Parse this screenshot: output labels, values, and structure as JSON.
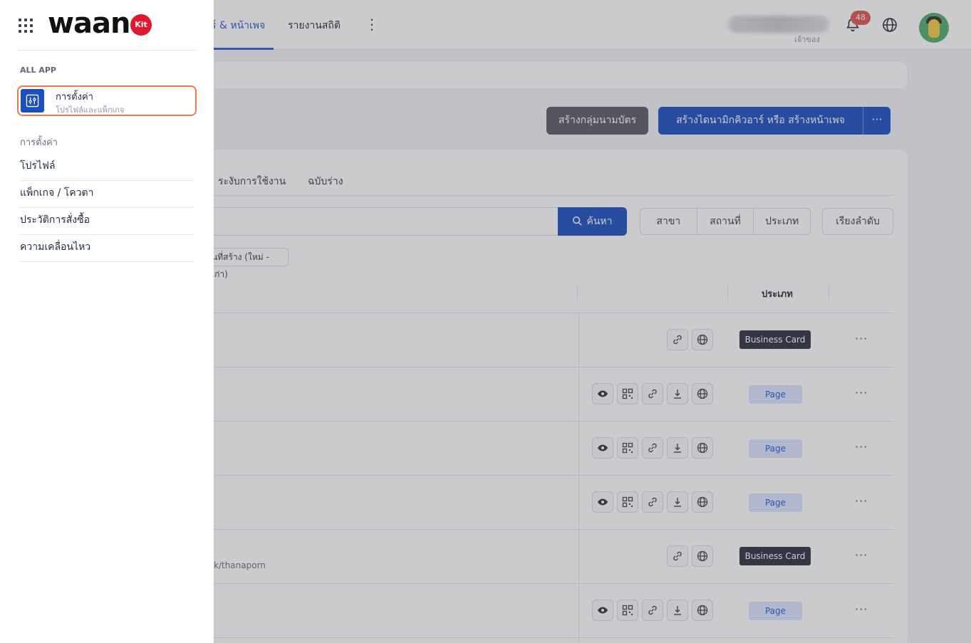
{
  "topnav": {
    "tabs": [
      {
        "label": "ร์ & หน้าเพจ",
        "active": true
      },
      {
        "label": "รายงานสถิติ",
        "active": false
      }
    ],
    "user_role": "เจ้าของ",
    "notification_count": "48"
  },
  "actions": {
    "create_group": "สร้างกลุ่มนามบัตร",
    "create_dynamic": "สร้างไดนามิกคิวอาร์ หรือ สร้างหน้าเพจ",
    "more": "···"
  },
  "panel": {
    "tabs": [
      "ระงับการใช้งาน",
      "ฉบับร่าง"
    ],
    "search_button": "ค้นหา",
    "filters": [
      "สาขา",
      "สถานที่",
      "ประเภท"
    ],
    "sort_button": "เรียงลำดับ",
    "active_chip": "นที่สร้าง (ใหม่ - เก่า)",
    "col_type": "ประเภท",
    "rows": [
      {
        "type": "Business Card"
      },
      {
        "type": "Page"
      },
      {
        "type": "Page"
      },
      {
        "type": "Page"
      },
      {
        "type": "Business Card",
        "url": "k/thanaporn"
      },
      {
        "type": "Page"
      }
    ]
  },
  "drawer": {
    "logo_text": "waan",
    "logo_badge": "Kit",
    "all_app_label": "ALL APP",
    "app": {
      "title": "การตั้งค่า",
      "subtitle": "โปรไฟล์และแพ็กเกจ"
    },
    "section_title": "การตั้งค่า",
    "menu": [
      "โปรไฟล์",
      "แพ็กเกจ / โควตา",
      "ประวัติการสั่งซื้อ",
      "ความเคลื่อนไหว"
    ]
  },
  "colors": {
    "primary": "#1e4fbf",
    "accent_outline": "#f07a47",
    "brand_red": "#e0192f",
    "badge_red": "#e2554e"
  }
}
